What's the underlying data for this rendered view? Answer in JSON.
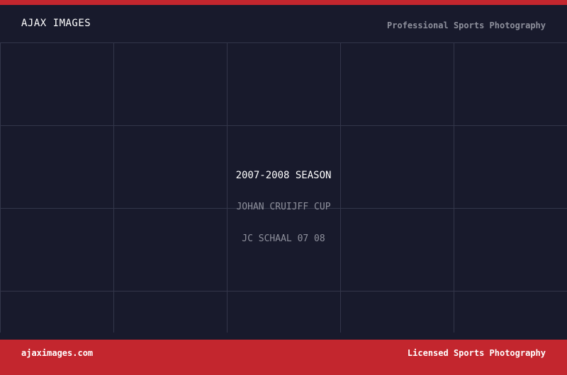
{
  "header": {
    "brand": "AJAX IMAGES",
    "tagline": "Professional Sports Photography"
  },
  "content": {
    "season_title": "2007-2008 SEASON",
    "items": [
      "JOHAN CRUIJFF CUP",
      "JC SCHAAL 07 08"
    ]
  },
  "footer": {
    "site": "ajaximages.com",
    "license": "Licensed Sports Photography"
  },
  "colors": {
    "background": "#181a2c",
    "accent_red": "#c3262e",
    "grid_line": "#33364a",
    "muted_text": "#8e909c",
    "text": "#ffffff"
  }
}
